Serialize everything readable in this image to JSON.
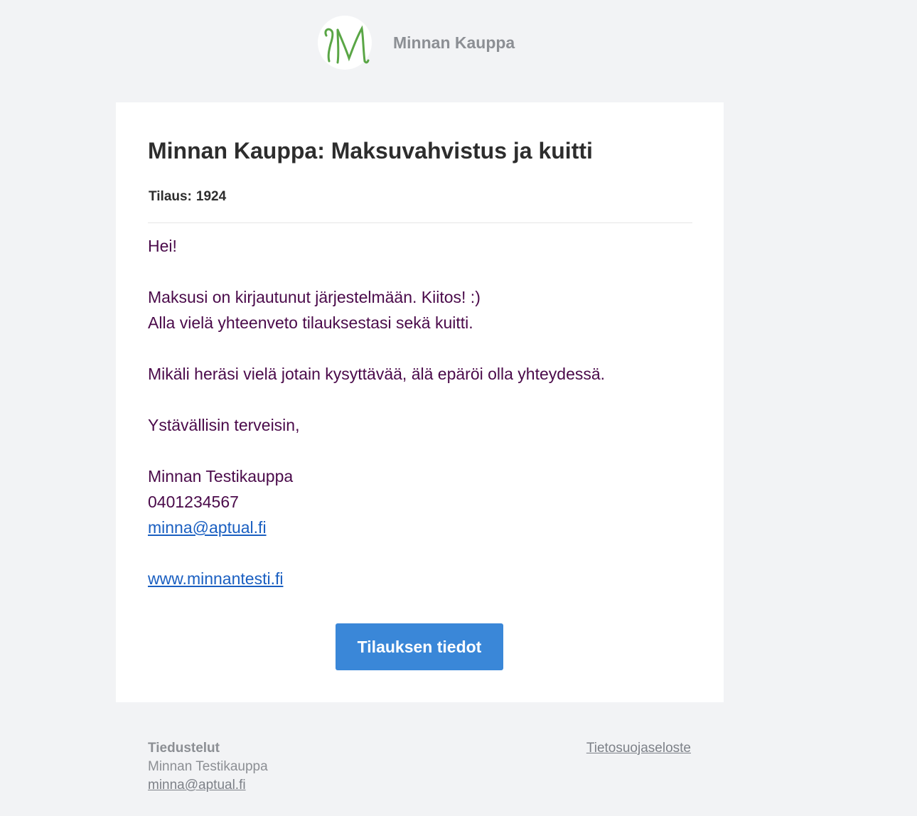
{
  "header": {
    "logo_icon": "script-m-logo-icon",
    "logo_color": "#5aa646",
    "shop_name": "Minnan Kauppa"
  },
  "email": {
    "title": "Minnan Kauppa: Maksuvahvistus ja kuitti",
    "order_label": "Tilaus:",
    "order_number": "1924",
    "greeting": "Hei!",
    "line1": "Maksusi on kirjautunut järjestelmään. Kiitos! :)",
    "line2": "Alla vielä yhteenveto tilauksestasi sekä kuitti.",
    "line3": "Mikäli heräsi vielä jotain kysyttävää, älä epäröi olla yhteydessä.",
    "closing": "Ystävällisin terveisin,",
    "signature_name": "Minnan Testikauppa",
    "signature_phone": "0401234567",
    "signature_email": "minna@aptual.fi",
    "signature_website": "www.minnantesti.fi",
    "button_label": "Tilauksen tiedot",
    "text_color": "#4a0a4a",
    "button_color": "#3a87d8"
  },
  "footer": {
    "title": "Tiedustelut",
    "name": "Minnan Testikauppa",
    "email": "minna@aptual.fi",
    "privacy_link": "Tietosuojaseloste"
  }
}
